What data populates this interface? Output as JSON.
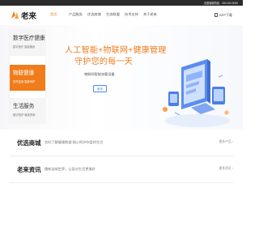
{
  "topbar": {
    "hotline": "全国客服热线：400-000-0000"
  },
  "header": {
    "brand": "老来",
    "nav": [
      {
        "label": "首页"
      },
      {
        "label": "产品服务"
      },
      {
        "label": "优选商城"
      },
      {
        "label": "生态联盟"
      },
      {
        "label": "技术支持"
      },
      {
        "label": "关于老来"
      }
    ],
    "app_download": "APP下载"
  },
  "hero": {
    "side_menu": [
      {
        "title": "数字医疗健康",
        "sub": "数字医疗 智能随身"
      },
      {
        "title": "物联健康",
        "sub": "实时监测 智能呵护"
      },
      {
        "title": "生活服务",
        "sub": "随访陪护 健康咨询"
      }
    ],
    "title_line1": "人工智能+物联网+健康管理",
    "title_line2": "守护您的每一天",
    "subtitle": "物联网智能穿戴设备",
    "button": "更多"
  },
  "sections": [
    {
      "label": "优选商城",
      "desc": "实时了解健康数据 随心呵护你爱的生活",
      "more": "更多产品 ›"
    },
    {
      "label": "老来资讯",
      "desc": "播新连接世界，让面对生活更美好",
      "more": "更多资讯 ›"
    }
  ],
  "colors": {
    "accent": "#f07c1b",
    "dark_bar": "#2b2b2b",
    "button_blue": "#4a8ae6"
  }
}
